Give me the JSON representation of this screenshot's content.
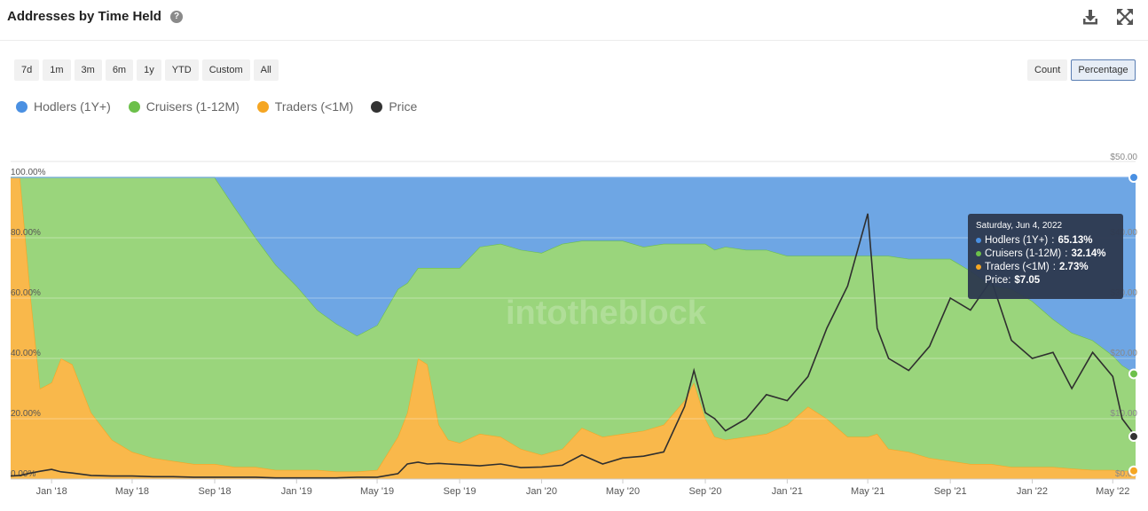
{
  "header": {
    "title": "Addresses by Time Held",
    "help_icon": "?"
  },
  "icons": {
    "download": "download-icon",
    "expand": "fullscreen-icon",
    "help": "question-icon"
  },
  "range_buttons": [
    "7d",
    "1m",
    "3m",
    "6m",
    "1y",
    "YTD",
    "Custom",
    "All"
  ],
  "mode_buttons": [
    {
      "label": "Count",
      "active": false
    },
    {
      "label": "Percentage",
      "active": true
    }
  ],
  "legend": [
    {
      "label": "Hodlers (1Y+)",
      "color": "#4a90e2"
    },
    {
      "label": "Cruisers (1-12M)",
      "color": "#6cc04a"
    },
    {
      "label": "Traders (<1M)",
      "color": "#f5a623"
    },
    {
      "label": "Price",
      "color": "#333333"
    }
  ],
  "tooltip": {
    "date": "Saturday, Jun 4, 2022",
    "rows": [
      {
        "name": "Hodlers (1Y+)",
        "value": "65.13%",
        "color": "#4a90e2"
      },
      {
        "name": "Cruisers (1-12M)",
        "value": "32.14%",
        "color": "#6cc04a"
      },
      {
        "name": "Traders (<1M)",
        "value": "2.73%",
        "color": "#f5a623"
      }
    ],
    "price_label": "Price:",
    "price_value": "$7.05"
  },
  "watermark": "intotheblock",
  "chart_data": {
    "type": "area",
    "stacked": true,
    "x_tick_labels": [
      "Jan '18",
      "May '18",
      "Sep '18",
      "Jan '19",
      "May '19",
      "Sep '19",
      "Jan '20",
      "May '20",
      "Sep '20",
      "Jan '21",
      "May '21",
      "Sep '21",
      "Jan '22",
      "May '22"
    ],
    "y_left_ticks": [
      "0.00%",
      "20.00%",
      "40.00%",
      "60.00%",
      "80.00%",
      "100.00%"
    ],
    "y_right_ticks": [
      "$0.00",
      "$10.00",
      "$20.00",
      "$30.00",
      "$40.00",
      "$50.00"
    ],
    "ylim_left": [
      0,
      100
    ],
    "ylim_right": [
      0,
      50
    ],
    "x_start": "2017-11-01",
    "x_end": "2022-06-04",
    "x": [
      "2017-11-01",
      "2017-11-15",
      "2017-12-01",
      "2017-12-15",
      "2018-01-01",
      "2018-01-15",
      "2018-02-01",
      "2018-03-01",
      "2018-04-01",
      "2018-05-01",
      "2018-06-01",
      "2018-07-01",
      "2018-08-01",
      "2018-09-01",
      "2018-10-01",
      "2018-11-01",
      "2018-12-01",
      "2019-01-01",
      "2019-02-01",
      "2019-03-01",
      "2019-04-01",
      "2019-05-01",
      "2019-06-01",
      "2019-06-15",
      "2019-07-01",
      "2019-07-15",
      "2019-08-01",
      "2019-08-15",
      "2019-09-01",
      "2019-10-01",
      "2019-11-01",
      "2019-12-01",
      "2020-01-01",
      "2020-02-01",
      "2020-03-01",
      "2020-04-01",
      "2020-05-01",
      "2020-06-01",
      "2020-07-01",
      "2020-08-01",
      "2020-08-15",
      "2020-09-01",
      "2020-09-15",
      "2020-10-01",
      "2020-11-01",
      "2020-12-01",
      "2021-01-01",
      "2021-02-01",
      "2021-03-01",
      "2021-04-01",
      "2021-05-01",
      "2021-05-15",
      "2021-06-01",
      "2021-07-01",
      "2021-08-01",
      "2021-09-01",
      "2021-10-01",
      "2021-11-01",
      "2021-12-01",
      "2022-01-01",
      "2022-02-01",
      "2022-03-01",
      "2022-04-01",
      "2022-05-01",
      "2022-05-15",
      "2022-06-04"
    ],
    "series": [
      {
        "name": "Traders (<1M)",
        "color": "#f5a623",
        "values": [
          100,
          100,
          60,
          30,
          32,
          40,
          38,
          22,
          13,
          9,
          7,
          6,
          5,
          5,
          4,
          4,
          3,
          3,
          3,
          2.5,
          2.5,
          3,
          14,
          22,
          40,
          38,
          18,
          13,
          12,
          15,
          14,
          10,
          8,
          10,
          17,
          14,
          15,
          16,
          18,
          26,
          32,
          20,
          14,
          13,
          14,
          15,
          18,
          24,
          20,
          14,
          14,
          15,
          10,
          9,
          7,
          6,
          5,
          5,
          4,
          4,
          4,
          3.5,
          3,
          3,
          2.7,
          2.73
        ]
      },
      {
        "name": "Cruisers (1-12M)",
        "color": "#6cc04a",
        "values": [
          0,
          0,
          40,
          70,
          68,
          60,
          62,
          78,
          87,
          91,
          93,
          94,
          95,
          95,
          86,
          76,
          68,
          61,
          53,
          49,
          45,
          48,
          49,
          43,
          30,
          32,
          52,
          57,
          58,
          62,
          64,
          66,
          67,
          68,
          62,
          65,
          64,
          61,
          60,
          52,
          46,
          58,
          62,
          64,
          62,
          61,
          56,
          50,
          54,
          60,
          60,
          59,
          64,
          64,
          66,
          67,
          64,
          59,
          59,
          55,
          49,
          45,
          43,
          38,
          35,
          32.14
        ]
      },
      {
        "name": "Hodlers (1Y+)",
        "color": "#4a90e2",
        "values": [
          0,
          0,
          0,
          0,
          0,
          0,
          0,
          0,
          0,
          0,
          0,
          0,
          0,
          0,
          10,
          20,
          29,
          36,
          44,
          48.5,
          52.5,
          49,
          37,
          35,
          30,
          30,
          30,
          30,
          30,
          23,
          22,
          24,
          25,
          22,
          21,
          21,
          21,
          23,
          22,
          22,
          22,
          22,
          24,
          23,
          24,
          24,
          26,
          26,
          26,
          26,
          26,
          26,
          26,
          27,
          27,
          27,
          31,
          36,
          37,
          41,
          47,
          51.5,
          54,
          59,
          62.3,
          65.13
        ]
      },
      {
        "name": "Price",
        "color": "#333333",
        "axis": "right",
        "values": [
          0.5,
          0.6,
          1.0,
          1.3,
          1.6,
          1.2,
          1.0,
          0.6,
          0.5,
          0.5,
          0.4,
          0.4,
          0.3,
          0.3,
          0.3,
          0.3,
          0.2,
          0.2,
          0.2,
          0.2,
          0.3,
          0.3,
          0.9,
          2.5,
          2.8,
          2.5,
          2.6,
          2.5,
          2.4,
          2.2,
          2.5,
          1.9,
          2.0,
          2.3,
          4.0,
          2.5,
          3.5,
          3.8,
          4.5,
          12,
          18,
          11,
          10,
          8,
          10,
          14,
          13,
          17,
          25,
          32,
          44,
          25,
          20,
          18,
          22,
          30,
          28,
          33,
          23,
          20,
          21,
          15,
          21,
          17,
          10,
          7.05
        ]
      }
    ]
  }
}
